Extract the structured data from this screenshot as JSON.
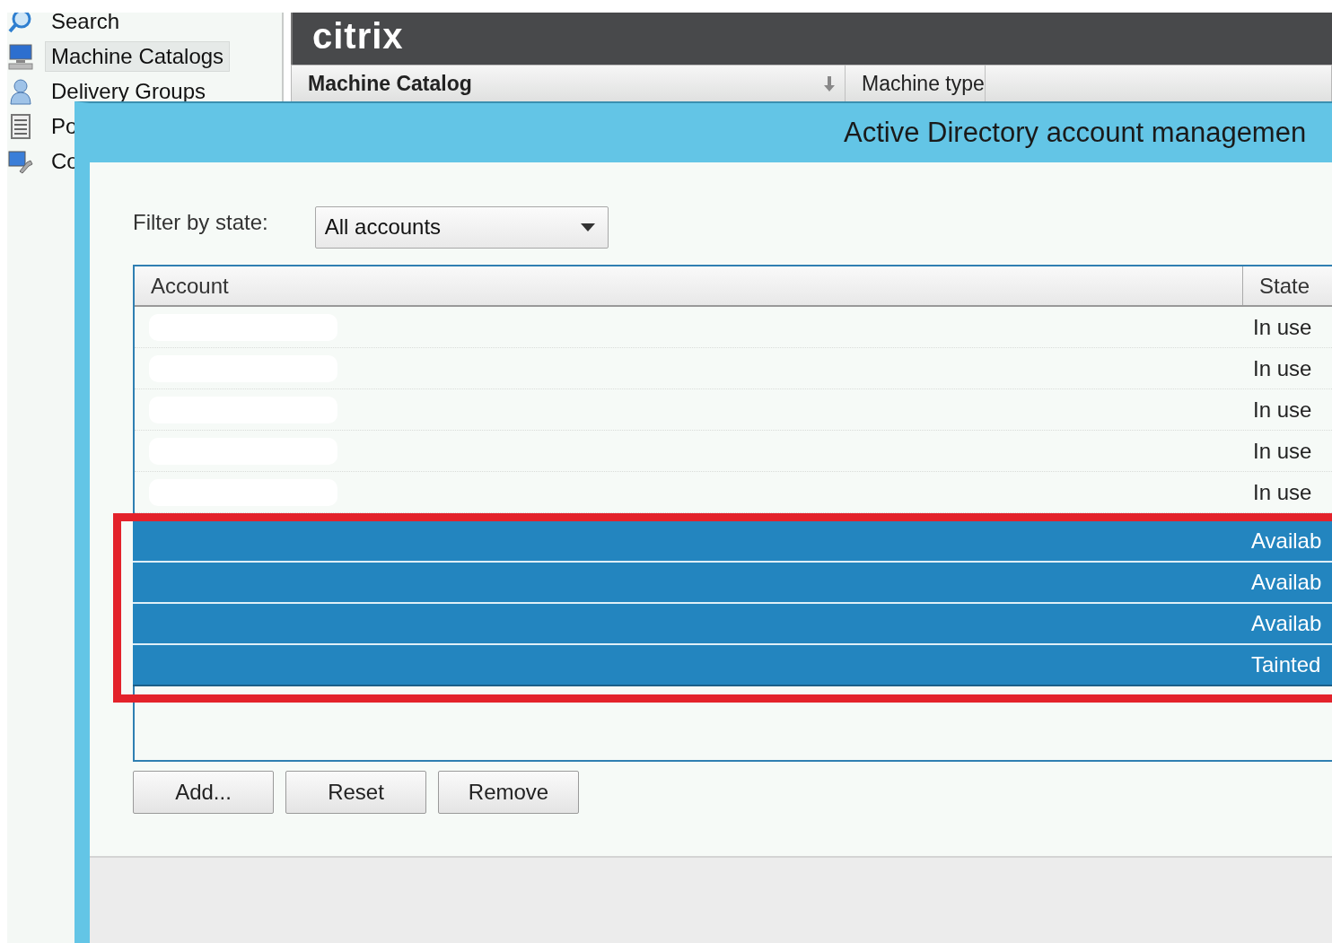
{
  "sidebar": {
    "items": [
      {
        "label": "Search",
        "selected": false
      },
      {
        "label": "Machine Catalogs",
        "selected": true
      },
      {
        "label": "Delivery Groups",
        "selected": false
      },
      {
        "label": "Po",
        "selected": false
      },
      {
        "label": "Co",
        "selected": false
      }
    ]
  },
  "console": {
    "logo": "citrix",
    "columns": [
      {
        "label": "Machine Catalog",
        "sorted": true
      },
      {
        "label": "Machine type",
        "sorted": false
      }
    ]
  },
  "dialog": {
    "title": "Active Directory account managemen",
    "filter": {
      "label": "Filter by state:",
      "value": "All accounts"
    },
    "table": {
      "columns": [
        "Account",
        "State"
      ],
      "rows": [
        {
          "state": "In use",
          "selected": false,
          "redacted": true
        },
        {
          "state": "In use",
          "selected": false,
          "redacted": true
        },
        {
          "state": "In use",
          "selected": false,
          "redacted": true
        },
        {
          "state": "In use",
          "selected": false,
          "redacted": true
        },
        {
          "state": "In use",
          "selected": false,
          "redacted": true
        },
        {
          "state": "Availab",
          "selected": true,
          "redacted": false
        },
        {
          "state": "Availab",
          "selected": true,
          "redacted": false
        },
        {
          "state": "Availab",
          "selected": true,
          "redacted": false
        },
        {
          "state": "Tainted",
          "selected": true,
          "redacted": false
        }
      ]
    },
    "buttons": [
      "Add...",
      "Reset",
      "Remove"
    ],
    "highlight": true
  }
}
